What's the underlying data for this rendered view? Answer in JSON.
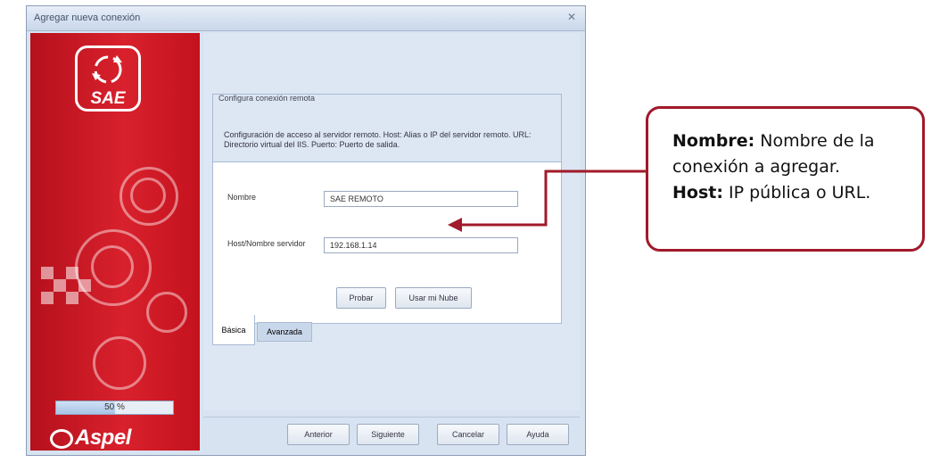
{
  "window": {
    "title": "Agregar nueva conexión",
    "close_glyph": "✕"
  },
  "sidebar": {
    "logo_text": "SAE",
    "progress": {
      "label": "50 %",
      "value": 0.5
    },
    "brand": "Aspel"
  },
  "group": {
    "title": "Configura conexión remota",
    "description": "Configuración de acceso al servidor remoto. Host: Alias o IP del servidor remoto. URL: Directorio virtual del IIS. Puerto: Puerto de salida."
  },
  "form": {
    "nombre_label": "Nombre",
    "nombre_value": "SAE REMOTO",
    "host_label": "Host/Nombre servidor",
    "host_value": "192.168.1.14",
    "probar_label": "Probar",
    "nube_label": "Usar mi Nube"
  },
  "tabs": [
    {
      "label": "Básica",
      "active": true
    },
    {
      "label": "Avanzada",
      "active": false
    }
  ],
  "footer": {
    "anterior": "Anterior",
    "siguiente": "Siguiente",
    "cancelar": "Cancelar",
    "ayuda": "Ayuda"
  },
  "callout": {
    "nombre_term": "Nombre:",
    "nombre_text": " Nombre de la conexión a agregar.",
    "host_term": "Host:",
    "host_text": " IP pública o URL."
  },
  "colors": {
    "brand_red": "#c4121e",
    "callout_border": "#a01a2a",
    "window_bg": "#d8e3f1"
  }
}
